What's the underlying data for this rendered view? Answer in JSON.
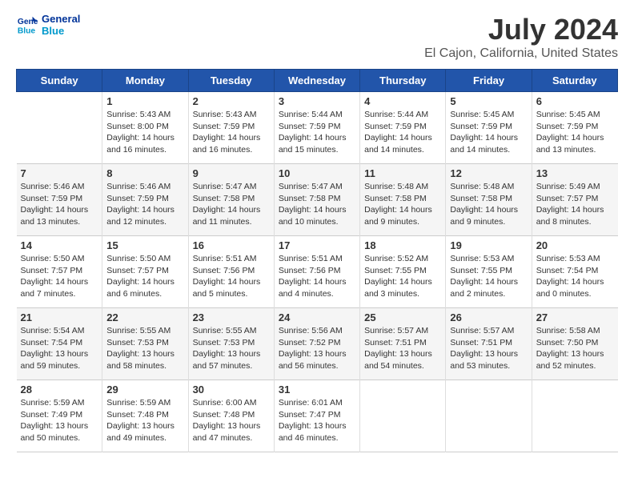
{
  "logo": {
    "line1": "General",
    "line2": "Blue"
  },
  "title": "July 2024",
  "subtitle": "El Cajon, California, United States",
  "days_of_week": [
    "Sunday",
    "Monday",
    "Tuesday",
    "Wednesday",
    "Thursday",
    "Friday",
    "Saturday"
  ],
  "weeks": [
    [
      {
        "num": "",
        "info": ""
      },
      {
        "num": "1",
        "info": "Sunrise: 5:43 AM\nSunset: 8:00 PM\nDaylight: 14 hours\nand 16 minutes."
      },
      {
        "num": "2",
        "info": "Sunrise: 5:43 AM\nSunset: 7:59 PM\nDaylight: 14 hours\nand 16 minutes."
      },
      {
        "num": "3",
        "info": "Sunrise: 5:44 AM\nSunset: 7:59 PM\nDaylight: 14 hours\nand 15 minutes."
      },
      {
        "num": "4",
        "info": "Sunrise: 5:44 AM\nSunset: 7:59 PM\nDaylight: 14 hours\nand 14 minutes."
      },
      {
        "num": "5",
        "info": "Sunrise: 5:45 AM\nSunset: 7:59 PM\nDaylight: 14 hours\nand 14 minutes."
      },
      {
        "num": "6",
        "info": "Sunrise: 5:45 AM\nSunset: 7:59 PM\nDaylight: 14 hours\nand 13 minutes."
      }
    ],
    [
      {
        "num": "7",
        "info": "Sunrise: 5:46 AM\nSunset: 7:59 PM\nDaylight: 14 hours\nand 13 minutes."
      },
      {
        "num": "8",
        "info": "Sunrise: 5:46 AM\nSunset: 7:59 PM\nDaylight: 14 hours\nand 12 minutes."
      },
      {
        "num": "9",
        "info": "Sunrise: 5:47 AM\nSunset: 7:58 PM\nDaylight: 14 hours\nand 11 minutes."
      },
      {
        "num": "10",
        "info": "Sunrise: 5:47 AM\nSunset: 7:58 PM\nDaylight: 14 hours\nand 10 minutes."
      },
      {
        "num": "11",
        "info": "Sunrise: 5:48 AM\nSunset: 7:58 PM\nDaylight: 14 hours\nand 9 minutes."
      },
      {
        "num": "12",
        "info": "Sunrise: 5:48 AM\nSunset: 7:58 PM\nDaylight: 14 hours\nand 9 minutes."
      },
      {
        "num": "13",
        "info": "Sunrise: 5:49 AM\nSunset: 7:57 PM\nDaylight: 14 hours\nand 8 minutes."
      }
    ],
    [
      {
        "num": "14",
        "info": "Sunrise: 5:50 AM\nSunset: 7:57 PM\nDaylight: 14 hours\nand 7 minutes."
      },
      {
        "num": "15",
        "info": "Sunrise: 5:50 AM\nSunset: 7:57 PM\nDaylight: 14 hours\nand 6 minutes."
      },
      {
        "num": "16",
        "info": "Sunrise: 5:51 AM\nSunset: 7:56 PM\nDaylight: 14 hours\nand 5 minutes."
      },
      {
        "num": "17",
        "info": "Sunrise: 5:51 AM\nSunset: 7:56 PM\nDaylight: 14 hours\nand 4 minutes."
      },
      {
        "num": "18",
        "info": "Sunrise: 5:52 AM\nSunset: 7:55 PM\nDaylight: 14 hours\nand 3 minutes."
      },
      {
        "num": "19",
        "info": "Sunrise: 5:53 AM\nSunset: 7:55 PM\nDaylight: 14 hours\nand 2 minutes."
      },
      {
        "num": "20",
        "info": "Sunrise: 5:53 AM\nSunset: 7:54 PM\nDaylight: 14 hours\nand 0 minutes."
      }
    ],
    [
      {
        "num": "21",
        "info": "Sunrise: 5:54 AM\nSunset: 7:54 PM\nDaylight: 13 hours\nand 59 minutes."
      },
      {
        "num": "22",
        "info": "Sunrise: 5:55 AM\nSunset: 7:53 PM\nDaylight: 13 hours\nand 58 minutes."
      },
      {
        "num": "23",
        "info": "Sunrise: 5:55 AM\nSunset: 7:53 PM\nDaylight: 13 hours\nand 57 minutes."
      },
      {
        "num": "24",
        "info": "Sunrise: 5:56 AM\nSunset: 7:52 PM\nDaylight: 13 hours\nand 56 minutes."
      },
      {
        "num": "25",
        "info": "Sunrise: 5:57 AM\nSunset: 7:51 PM\nDaylight: 13 hours\nand 54 minutes."
      },
      {
        "num": "26",
        "info": "Sunrise: 5:57 AM\nSunset: 7:51 PM\nDaylight: 13 hours\nand 53 minutes."
      },
      {
        "num": "27",
        "info": "Sunrise: 5:58 AM\nSunset: 7:50 PM\nDaylight: 13 hours\nand 52 minutes."
      }
    ],
    [
      {
        "num": "28",
        "info": "Sunrise: 5:59 AM\nSunset: 7:49 PM\nDaylight: 13 hours\nand 50 minutes."
      },
      {
        "num": "29",
        "info": "Sunrise: 5:59 AM\nSunset: 7:48 PM\nDaylight: 13 hours\nand 49 minutes."
      },
      {
        "num": "30",
        "info": "Sunrise: 6:00 AM\nSunset: 7:48 PM\nDaylight: 13 hours\nand 47 minutes."
      },
      {
        "num": "31",
        "info": "Sunrise: 6:01 AM\nSunset: 7:47 PM\nDaylight: 13 hours\nand 46 minutes."
      },
      {
        "num": "",
        "info": ""
      },
      {
        "num": "",
        "info": ""
      },
      {
        "num": "",
        "info": ""
      }
    ]
  ]
}
